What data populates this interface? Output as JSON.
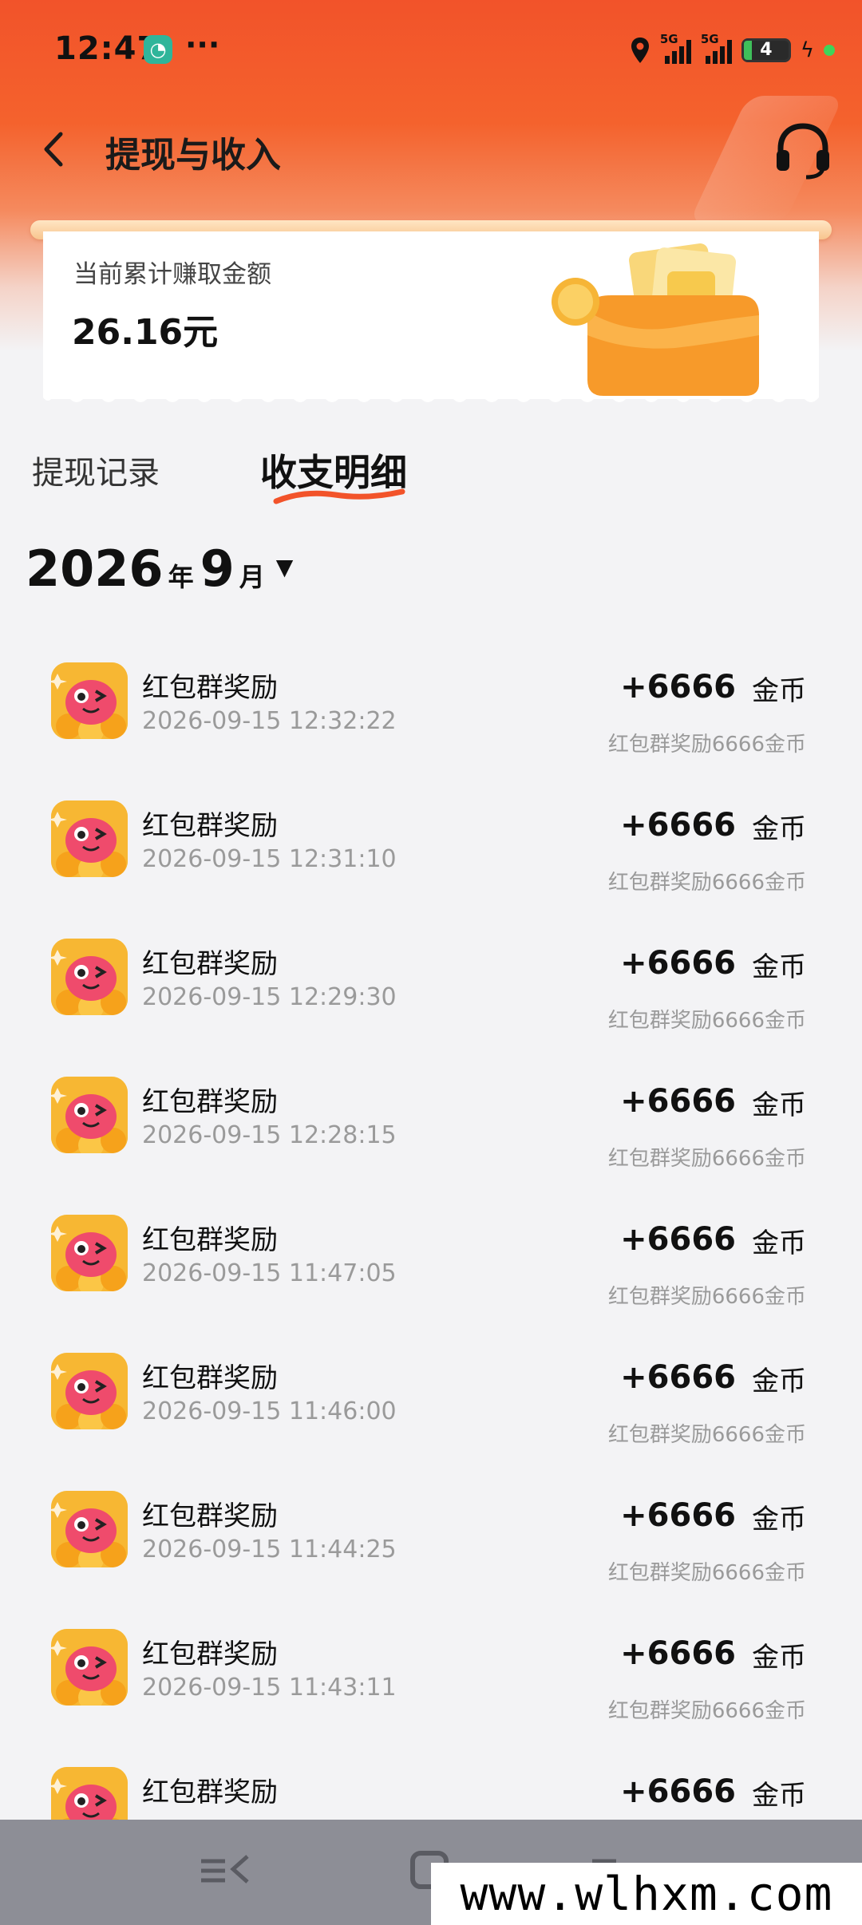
{
  "status_bar": {
    "time": "12:47",
    "more": "···",
    "signal_1": "5G",
    "signal_2": "5G",
    "battery": "4"
  },
  "header": {
    "title": "提现与收入"
  },
  "summary": {
    "label": "当前累计赚取金额",
    "amount": "26.16元"
  },
  "tabs": {
    "records": "提现记录",
    "detail": "收支明细"
  },
  "month": {
    "year": "2026",
    "year_unit": "年",
    "month": "9",
    "month_unit": "月",
    "caret": "▼"
  },
  "transactions": [
    {
      "title": "红包群奖励",
      "time": "2026-09-15 12:32:22",
      "amount": "+6666",
      "unit": "金币",
      "note": "红包群奖励6666金币"
    },
    {
      "title": "红包群奖励",
      "time": "2026-09-15 12:31:10",
      "amount": "+6666",
      "unit": "金币",
      "note": "红包群奖励6666金币"
    },
    {
      "title": "红包群奖励",
      "time": "2026-09-15 12:29:30",
      "amount": "+6666",
      "unit": "金币",
      "note": "红包群奖励6666金币"
    },
    {
      "title": "红包群奖励",
      "time": "2026-09-15 12:28:15",
      "amount": "+6666",
      "unit": "金币",
      "note": "红包群奖励6666金币"
    },
    {
      "title": "红包群奖励",
      "time": "2026-09-15 11:47:05",
      "amount": "+6666",
      "unit": "金币",
      "note": "红包群奖励6666金币"
    },
    {
      "title": "红包群奖励",
      "time": "2026-09-15 11:46:00",
      "amount": "+6666",
      "unit": "金币",
      "note": "红包群奖励6666金币"
    },
    {
      "title": "红包群奖励",
      "time": "2026-09-15 11:44:25",
      "amount": "+6666",
      "unit": "金币",
      "note": "红包群奖励6666金币"
    },
    {
      "title": "红包群奖励",
      "time": "2026-09-15 11:43:11",
      "amount": "+6666",
      "unit": "金币",
      "note": "红包群奖励6666金币"
    },
    {
      "title": "红包群奖励",
      "time": "",
      "amount": "+6666",
      "unit": "金币",
      "note": ""
    }
  ],
  "watermark": "www.wlhxm.com",
  "colors": {
    "brand": "#f2532a",
    "background": "#f3f3f5",
    "muted_text": "#9a9a9a"
  }
}
